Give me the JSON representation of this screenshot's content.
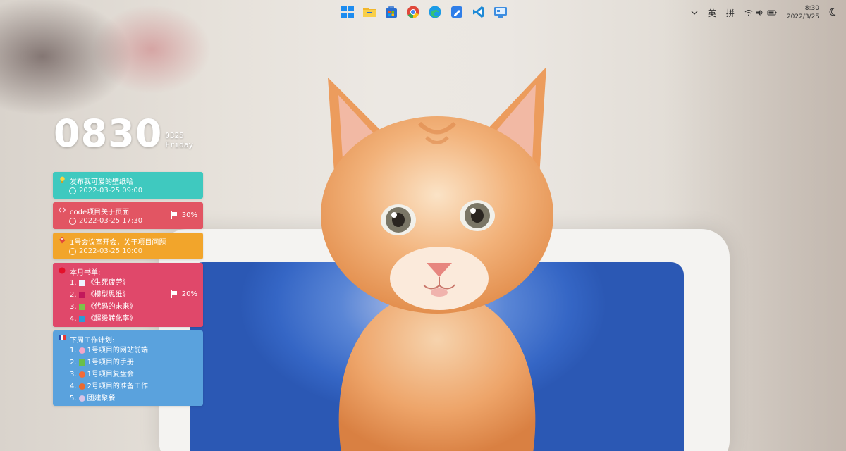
{
  "taskbar": {
    "apps": [
      {
        "name": "start-icon",
        "color": "#1d8cf0"
      },
      {
        "name": "file-explorer-icon",
        "color": "#f2b629"
      },
      {
        "name": "store-icon",
        "color": "#2a6fd1"
      },
      {
        "name": "chrome-icon",
        "color": "#e0483a"
      },
      {
        "name": "edge-icon",
        "color": "#1b9be6"
      },
      {
        "name": "notes-icon",
        "color": "#2f7ee8"
      },
      {
        "name": "vscode-icon",
        "color": "#1f8ad6"
      },
      {
        "name": "remote-desktop-icon",
        "color": "#3d8de0"
      }
    ],
    "tray": {
      "lang1": "英",
      "lang2": "拼",
      "time": "8:30",
      "date": "2022/3/25"
    }
  },
  "clock": {
    "time": "0830",
    "date": "0325",
    "weekday": "Friday"
  },
  "cards": [
    {
      "title": "发布我可爱的壁纸哈",
      "time": "2022-03-25 09:00",
      "color": "#3fc9bf",
      "icon": "lightbulb-icon"
    },
    {
      "title": "code项目关于页面",
      "time": "2022-03-25 17:30",
      "progress": "30%",
      "color": "#e25563",
      "icon": "code-icon"
    },
    {
      "title": "1号会议室开会，关于项目问题",
      "time": "2022-03-25 10:00",
      "color": "#f2a52b",
      "icon": "tag-icon"
    },
    {
      "title": "本月书单:",
      "progress": "20%",
      "color": "#e0486a",
      "icon": "red-dot-icon",
      "items": [
        {
          "label": "1.",
          "text": "《生死疲劳》",
          "swatch": "#eef3ff"
        },
        {
          "label": "2.",
          "text": "《模型思维》",
          "swatch": "#c2185b"
        },
        {
          "label": "3.",
          "text": "《代码的未来》",
          "swatch": "#7cc24a"
        },
        {
          "label": "4.",
          "text": "《超级转化率》",
          "swatch": "#2d9ad6"
        }
      ]
    },
    {
      "title": "下周工作计划:",
      "color": "#5aa2dd",
      "icon": "flag-fr-icon",
      "items": [
        {
          "label": "1.",
          "text": "1号项目的网站前端",
          "swatch": "#f3a6c8"
        },
        {
          "label": "2.",
          "text": "1号项目的手册",
          "swatch": "#6abf4b"
        },
        {
          "label": "3.",
          "text": "1号项目复盘会",
          "swatch": "#f26b38"
        },
        {
          "label": "4.",
          "text": "2号项目的准备工作",
          "swatch": "#ea6a2e"
        },
        {
          "label": "5.",
          "text": "团建聚餐",
          "swatch": "#d9c3e6"
        }
      ]
    }
  ]
}
